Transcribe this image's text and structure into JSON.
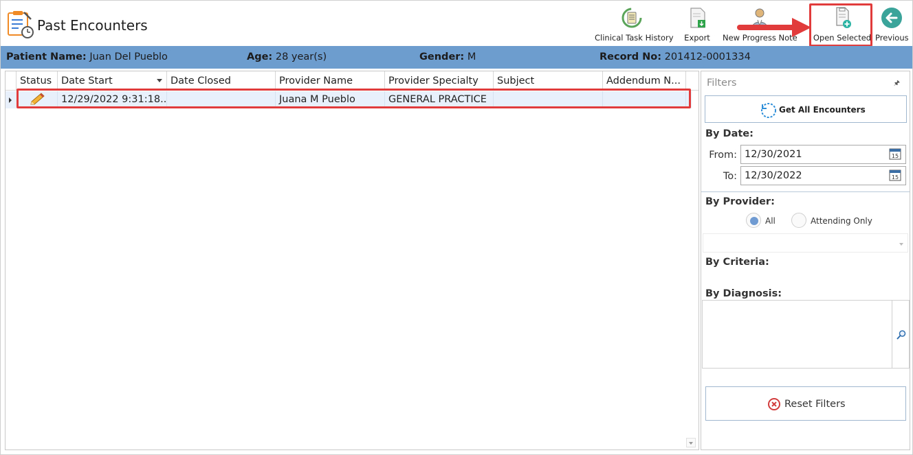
{
  "header": {
    "title": "Past Encounters"
  },
  "toolbar": {
    "clinical_task_history": "Clinical Task History",
    "export": "Export",
    "new_progress_note": "New Progress Note",
    "open_selected": "Open Selected",
    "previous": "Previous"
  },
  "patient": {
    "name_label": "Patient Name:",
    "name": "Juan Del Pueblo",
    "age_label": "Age:",
    "age": "28 year(s)",
    "gender_label": "Gender:",
    "gender": "M",
    "record_label": "Record No:",
    "record": "201412-0001334"
  },
  "grid": {
    "columns": [
      "Status",
      "Date Start",
      "Date Closed",
      "Provider Name",
      "Provider Specialty",
      "Subject",
      "Addendum N..."
    ],
    "rows": [
      {
        "status_icon": "pencil-icon",
        "date_start": "12/29/2022 9:31:18...",
        "date_closed": "",
        "provider_name": "Juana M Pueblo",
        "provider_specialty": "GENERAL PRACTICE",
        "subject": "",
        "addendum": ""
      }
    ]
  },
  "filters": {
    "title": "Filters",
    "get_all": "Get All Encounters",
    "by_date": "By Date:",
    "from_label": "From:",
    "from_value": "12/30/2021",
    "to_label": "To:",
    "to_value": "12/30/2022",
    "calendar_day": "15",
    "by_provider": "By Provider:",
    "radio_all": "All",
    "radio_attending": "Attending Only",
    "by_criteria": "By Criteria:",
    "by_diagnosis": "By Diagnosis:",
    "reset": "Reset Filters"
  },
  "colors": {
    "patient_bar": "#6d9ccf",
    "selected_row": "#e8f1fb",
    "highlight": "#e23b3b",
    "accent_teal": "#3aa39a"
  }
}
